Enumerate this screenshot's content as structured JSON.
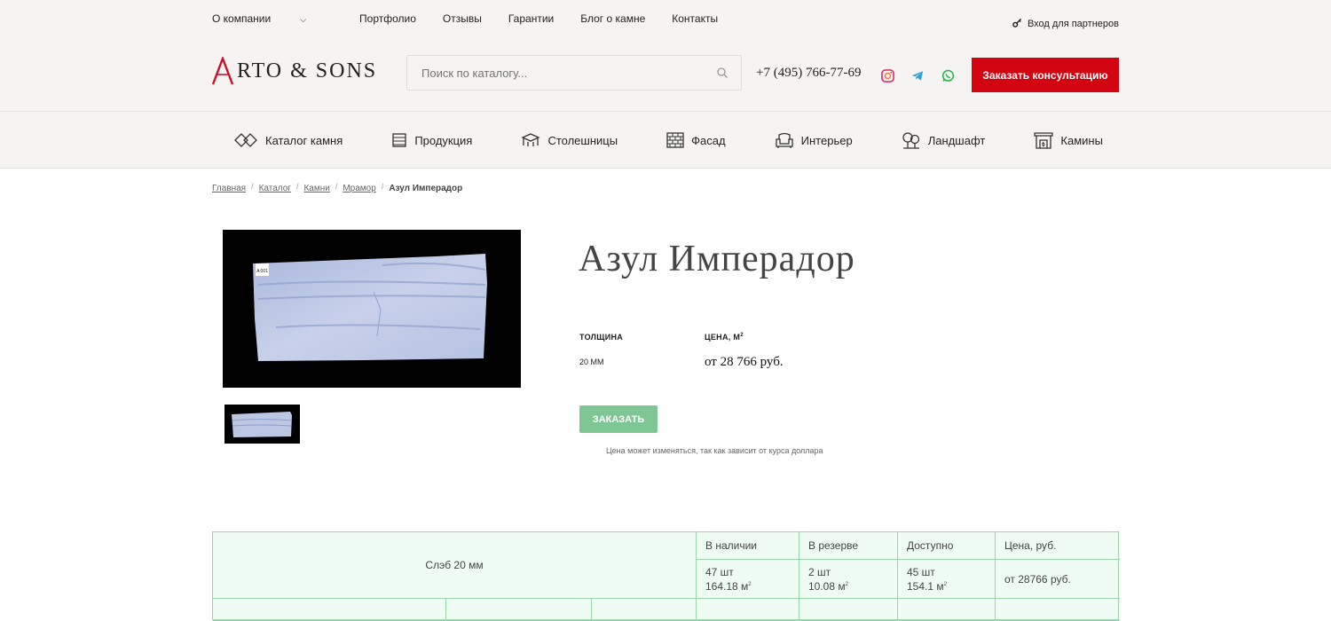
{
  "topnav": {
    "items": [
      "О компании",
      "Портфолио",
      "Отзывы",
      "Гарантии",
      "Блог о камне",
      "Контакты"
    ],
    "partner_label": "Вход для партнеров"
  },
  "logo": {
    "text": "RTO & SONS"
  },
  "search": {
    "placeholder": "Поиск по каталогу..."
  },
  "phone": "+7 (495) 766-77-69",
  "consult_button": "Заказать консультацию",
  "catnav": {
    "items": [
      "Каталог камня",
      "Продукция",
      "Столешницы",
      "Фасад",
      "Интерьер",
      "Ландшафт",
      "Камины"
    ]
  },
  "breadcrumb": {
    "items": [
      "Главная",
      "Каталог",
      "Камни",
      "Мрамор"
    ],
    "current": "Азул Имперадор"
  },
  "product": {
    "title": "Азул Имперадор",
    "thickness_label": "ТОЛЩИНА",
    "price_label": "ЦЕНА, М",
    "price_label_sup": "2",
    "thickness_value": "20 ММ",
    "price_value": "от 28 766 руб.",
    "order_button": "ЗАКАЗАТЬ",
    "note": "Цена может изменяться, так как зависит от курса доллара",
    "slab_label": "A 001"
  },
  "table": {
    "row_label": "Слэб 20 мм",
    "headers": [
      "В наличии",
      "В резерве",
      "Доступно",
      "Цена, руб."
    ],
    "values": [
      {
        "count": "47 шт",
        "area": "164.18 м",
        "sup": "2"
      },
      {
        "count": "2 шт",
        "area": "10.08 м",
        "sup": "2"
      },
      {
        "count": "45 шт",
        "area": "154.1 м",
        "sup": "2"
      }
    ],
    "price": "от 28766 руб."
  }
}
